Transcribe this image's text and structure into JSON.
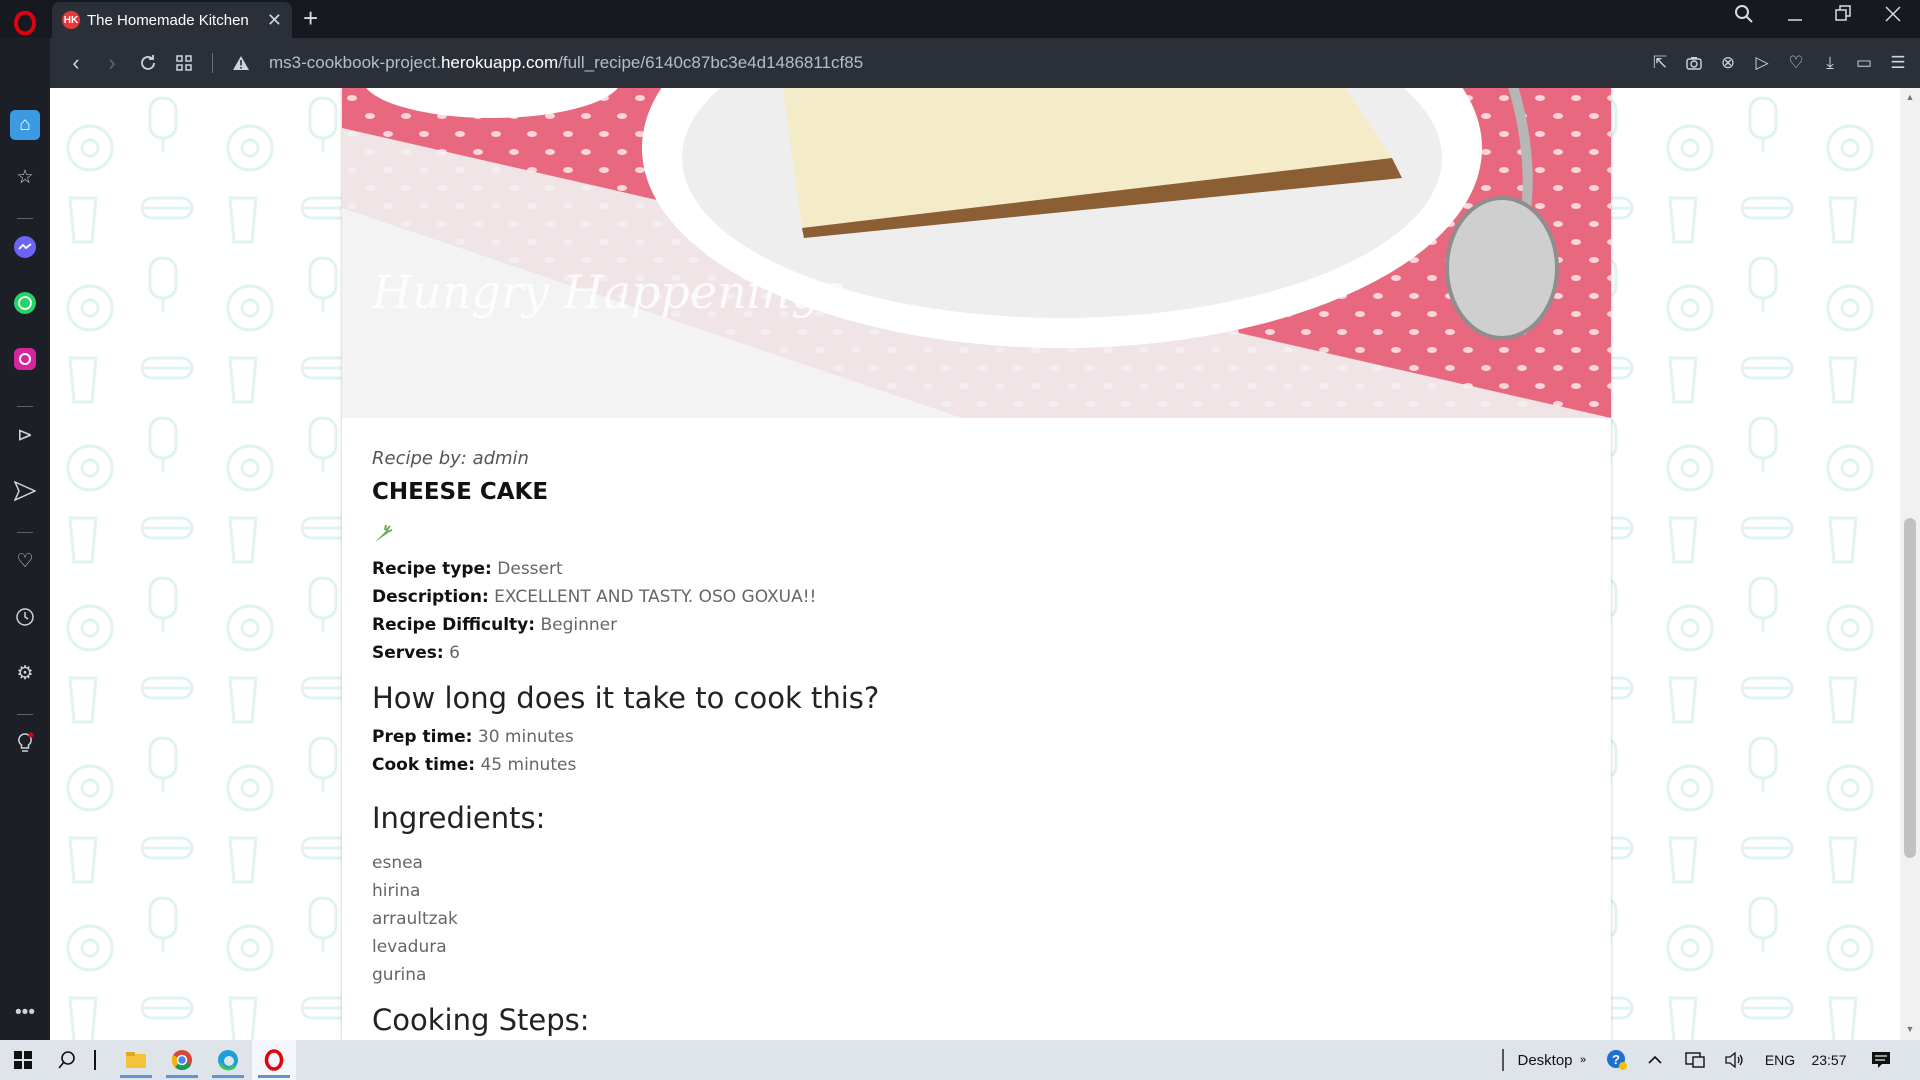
{
  "browser": {
    "tab_title": "The Homemade Kitchen",
    "tab_favicon_text": "HK",
    "url_prefix": "ms3-cookbook-project.",
    "url_host": "herokuapp.com",
    "url_path": "/full_recipe/6140c87bc3e4d1486811cf85"
  },
  "recipe": {
    "byline": "Recipe by: admin",
    "title": "CHEESE CAKE",
    "hero_watermark": "Hungry Happenings",
    "details": [
      {
        "label": "Recipe type:",
        "value": "Dessert"
      },
      {
        "label": "Description:",
        "value": "EXCELLENT AND TASTY. OSO GOXUA!!"
      },
      {
        "label": "Recipe Difficulty:",
        "value": "Beginner"
      },
      {
        "label": "Serves:",
        "value": "6"
      }
    ],
    "time_heading": "How long does it take to cook this?",
    "times": [
      {
        "label": "Prep time:",
        "value": "30 minutes"
      },
      {
        "label": "Cook time:",
        "value": "45 minutes"
      }
    ],
    "ingredients_heading": "Ingredients:",
    "ingredients": [
      "esnea",
      "hirina",
      "arraultzak",
      "levadura",
      "gurina"
    ],
    "steps_heading": "Cooking Steps:"
  },
  "taskbar": {
    "desktop_label": "Desktop",
    "language": "ENG",
    "time": "23:57"
  },
  "colors": {
    "accent_opera": "#e3000f",
    "pattern_icons": "#dff3f3",
    "page_bg": "#ffffff",
    "diet_icon": "#6aa84f"
  }
}
